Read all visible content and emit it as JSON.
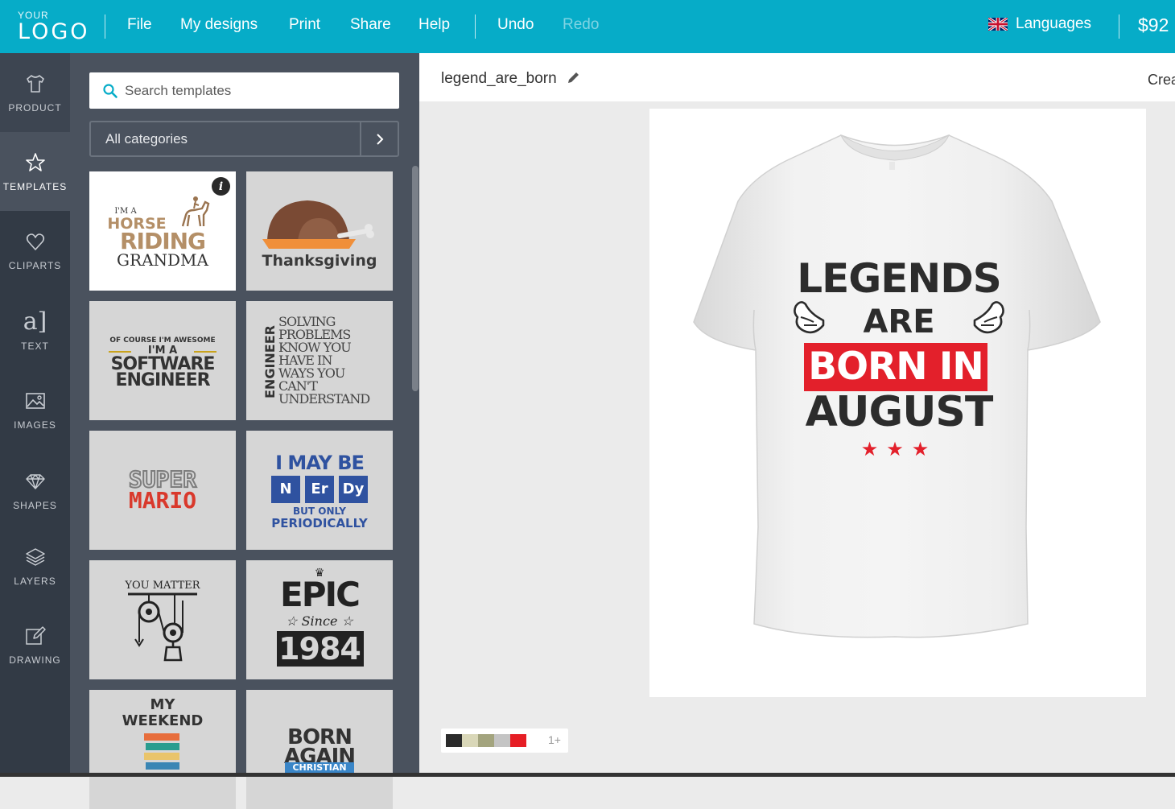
{
  "header": {
    "logo_small": "YOUR",
    "logo_big": "LOGO",
    "menu": {
      "file": "File",
      "my_designs": "My designs",
      "print": "Print",
      "share": "Share",
      "help": "Help",
      "undo": "Undo",
      "redo": "Redo"
    },
    "languages": "Languages",
    "price": "$92"
  },
  "sidebar": {
    "product": "PRODUCT",
    "templates": "TEMPLATES",
    "cliparts": "CLIPARTS",
    "text": "TEXT",
    "images": "IMAGES",
    "shapes": "SHAPES",
    "layers": "LAYERS",
    "drawing": "DRAWING",
    "active": "TEMPLATES"
  },
  "templates_panel": {
    "search_placeholder": "Search templates",
    "category": "All categories",
    "templates": {
      "horse": {
        "line1": "I'M A",
        "line2": "HORSE",
        "line3": "RIDING",
        "line4": "GRANDMA"
      },
      "thanksgiving": {
        "title": "Thanksgiving"
      },
      "software": {
        "line1": "OF COURSE I'M AWESOME",
        "line2": "I'M A",
        "line3": "SOFTWARE",
        "line4": "ENGINEER"
      },
      "engineer": {
        "vertical": "ENGINEER",
        "lines": [
          "SOLVING",
          "PROBLEMS",
          "KNOW YOU",
          "HAVE IN",
          "WAYS YOU",
          "CAN'T",
          "UNDERSTAND"
        ]
      },
      "mario": {
        "line1": "SUPER",
        "line2": "MARIO"
      },
      "nerdy": {
        "line1": "I MAY BE",
        "el1": "N",
        "el2": "Er",
        "el3": "Dy",
        "line2": "BUT ONLY",
        "line3": "PERIODICALLY"
      },
      "matter": {
        "title": "YOU MATTER"
      },
      "epic": {
        "line1": "EPIC",
        "line2": "Since",
        "line3": "1984"
      },
      "weekend": {
        "line1": "MY",
        "line2": "WEEKEND"
      },
      "born_again": {
        "line1": "BORN",
        "line2": "AGAIN",
        "line3": "CHRISTIAN"
      }
    }
  },
  "canvas": {
    "document_name": "legend_are_born",
    "create_label": "Crea",
    "design": {
      "line1": "LEGENDS",
      "line2": "ARE",
      "line3": "BORN IN",
      "line4": "AUGUST",
      "stars": "★★★"
    },
    "colors_more": "1+",
    "used_colors": [
      "#2b2b2b",
      "#d9d7b8",
      "#a3a47e",
      "#c4c4c4",
      "#e61e25"
    ]
  }
}
